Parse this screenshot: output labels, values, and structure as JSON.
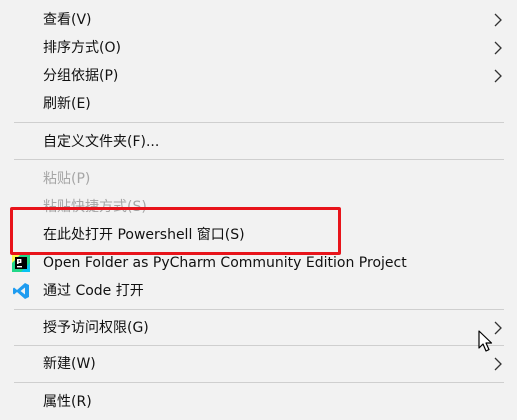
{
  "menu": {
    "view": "查看(V)",
    "sort": "排序方式(O)",
    "group": "分组依据(P)",
    "refresh": "刷新(E)",
    "customize": "自定义文件夹(F)...",
    "paste": "粘贴(P)",
    "paste_shortcut": "粘贴快捷方式(S)",
    "open_powershell": "在此处打开 Powershell 窗口(S)",
    "pycharm": "Open Folder as PyCharm Community Edition Project",
    "vscode": "通过 Code 打开",
    "grant_access": "授予访问权限(G)",
    "new": "新建(W)",
    "properties": "属性(R)"
  },
  "colors": {
    "highlight_box": "#e8141b",
    "vscode_blue": "#1f9cf0",
    "disabled_text": "#a6a6a6"
  },
  "icons": {
    "pycharm": "pycharm-icon",
    "vscode": "vscode-icon",
    "submenu": "chevron-right-icon"
  }
}
